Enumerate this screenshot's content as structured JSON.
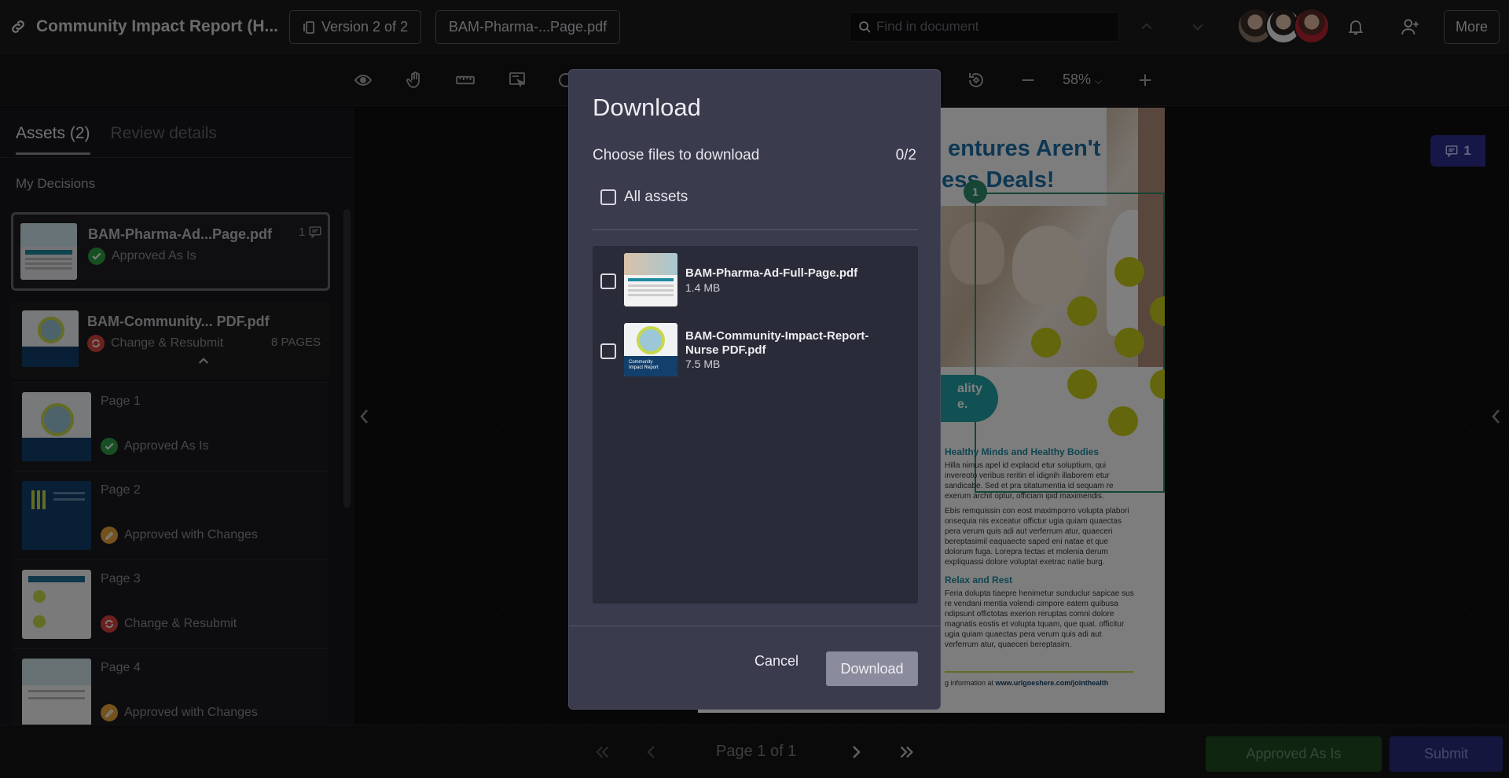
{
  "header": {
    "title": "Community Impact Report (H...",
    "version_label": "Version 2 of 2",
    "file_label": "BAM-Pharma-...Page.pdf",
    "search_placeholder": "Find in document",
    "more_label": "More"
  },
  "toolbar": {
    "zoom": "58%"
  },
  "sidebar": {
    "tab_assets": "Assets (2)",
    "tab_review": "Review details",
    "section_label": "My Decisions",
    "assets": [
      {
        "name": "BAM-Pharma-Ad...Page.pdf",
        "status": "Approved As Is",
        "comments": "1"
      },
      {
        "name": "BAM-Community... PDF.pdf",
        "status": "Change & Resubmit",
        "pages": "8 PAGES"
      }
    ],
    "pages": [
      {
        "label": "Page 1",
        "status": "Approved As Is"
      },
      {
        "label": "Page 2",
        "status": "Approved with Changes"
      },
      {
        "label": "Page 3",
        "status": "Change & Resubmit"
      },
      {
        "label": "Page 4",
        "status": "Approved with Changes"
      }
    ]
  },
  "document": {
    "headline_1": "entures Aren't",
    "headline_2": "ess Deals!",
    "marker": "1",
    "pill_text_1": "ality",
    "pill_text_2": "e.",
    "h1": "Healthy Minds and Healthy Bodies",
    "p1": "Hilla nimus apel id explacid etur soluptium, qui invereoto veribus reritin el idignih illaborem etur sandicabe. Sed et pra sitatumentia id sequam re exerum archit optur, officiam ipid maximendis.",
    "p2": "Ebis remquissin con eost maximporro volupta plabori onsequia nis exceatur offictur ugia quiam quaectas pera verum quis adi aut verferrum atur, quaeceri bereptasimil eaquaecte saped eni natae et que dolorum fuga. Lorepra tectas et molenia derum expliquassi dolore voluptat exetrac natie burg.",
    "h2": "Relax and Rest",
    "p3": "Feria dolupta tiaepre henimetur sunduclur sapicae sus re vendani mentia volendi cimpore eatem quibusa ndipsunt offictotas exerion reruptas comni dolore magnatis eostis et volupta tquam, que quat. officitur ugia quiam quaectas pera verum quis adi aut verferrum atur, quaeceri bereptasim.",
    "footer_prefix": "g information at ",
    "footer_url": "www.urlgoeshere.com/jointhealth",
    "comment_count": "1"
  },
  "bottom": {
    "pager": "Page 1 of 1",
    "approve_label": "Approved As Is",
    "submit_label": "Submit"
  },
  "modal": {
    "title": "Download",
    "choose_label": "Choose files to download",
    "count": "0/2",
    "all_label": "All assets",
    "files": [
      {
        "name": "BAM-Pharma-Ad-Full-Page.pdf",
        "size": "1.4 MB"
      },
      {
        "name": "BAM-Community-Impact-Report-Nurse PDF.pdf",
        "size": "7.5 MB"
      }
    ],
    "thumb_caption": "Community Impact Report",
    "cancel_label": "Cancel",
    "download_label": "Download"
  },
  "colors": {
    "approved": "#2f9e44",
    "changes": "#e8a33a",
    "resubmit": "#d6453d",
    "accent": "#2c2f8e"
  }
}
